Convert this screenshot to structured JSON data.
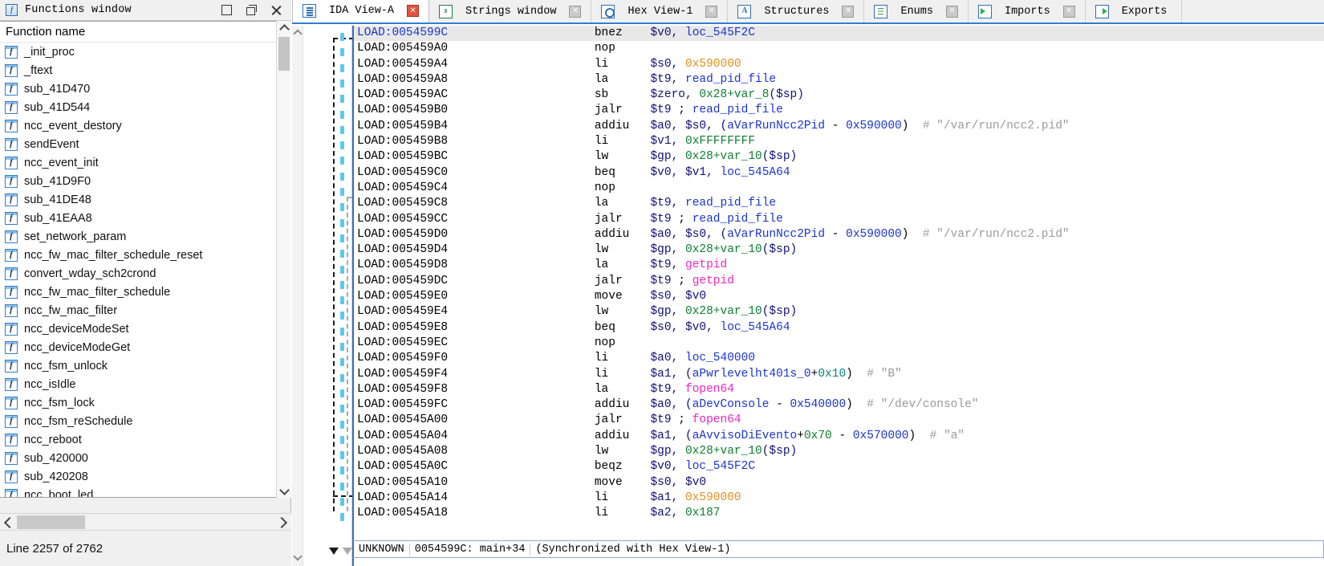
{
  "colors": {
    "accent": "#2f7fd0",
    "cursor_line_bg": "#e8e8e8",
    "address_blue": "#1a35cf",
    "name_green": "#0f8030",
    "number_teal": "#0f8080",
    "immediate_orange": "#e09020",
    "extern_magenta": "#ee25c4",
    "comment_gray": "#9a9a9a",
    "register_navy": "#10107a",
    "arrow_dot_blue": "#5bc8f0"
  },
  "functions_window": {
    "title": "Functions window",
    "title_icon": "function-icon",
    "window_buttons": [
      {
        "name": "restore-button",
        "glyph": "restore"
      },
      {
        "name": "cascade-button",
        "glyph": "cascade"
      },
      {
        "name": "close-button",
        "glyph": "close"
      }
    ],
    "column_header": "Function name",
    "row_icon": "function-icon",
    "items": [
      "_init_proc",
      "_ftext",
      "sub_41D470",
      "sub_41D544",
      "ncc_event_destory",
      "sendEvent",
      "ncc_event_init",
      "sub_41D9F0",
      "sub_41DE48",
      "sub_41EAA8",
      "set_network_param",
      "ncc_fw_mac_filter_schedule_reset",
      "convert_wday_sch2crond",
      "ncc_fw_mac_filter_schedule",
      "ncc_fw_mac_filter",
      "ncc_deviceModeSet",
      "ncc_deviceModeGet",
      "ncc_fsm_unlock",
      "ncc_isIdle",
      "ncc_fsm_lock",
      "ncc_fsm_reSchedule",
      "ncc_reboot",
      "sub_420000",
      "sub_420208",
      "ncc_boot_led"
    ],
    "status": "Line 2257 of 2762"
  },
  "tabs": [
    {
      "label": "IDA View-A",
      "icon": "disassembly-view-icon",
      "active": true,
      "closable": true
    },
    {
      "label": "Strings window",
      "icon": "strings-icon",
      "active": false,
      "closable": true
    },
    {
      "label": "Hex View-1",
      "icon": "hex-view-icon",
      "active": false,
      "closable": true
    },
    {
      "label": "Structures",
      "icon": "structures-icon",
      "active": false,
      "closable": true
    },
    {
      "label": "Enums",
      "icon": "enums-icon",
      "active": false,
      "closable": true
    },
    {
      "label": "Imports",
      "icon": "imports-icon",
      "active": false,
      "closable": true
    },
    {
      "label": "Exports",
      "icon": "exports-icon",
      "active": false,
      "closable": false
    }
  ],
  "disassembly": {
    "lines": [
      {
        "addr": "LOAD:0054599C",
        "mnem": "bnez",
        "cursor": true,
        "ops": [
          {
            "t": "$v0, ",
            "c": "reg"
          },
          {
            "t": "loc_545F2C",
            "c": "c-blue"
          }
        ]
      },
      {
        "addr": "LOAD:005459A0",
        "mnem": "nop",
        "ops": []
      },
      {
        "addr": "LOAD:005459A4",
        "mnem": "li",
        "ops": [
          {
            "t": "$s0, ",
            "c": "reg"
          },
          {
            "t": "0x590000",
            "c": "c-orange"
          }
        ]
      },
      {
        "addr": "LOAD:005459A8",
        "mnem": "la",
        "ops": [
          {
            "t": "$t9, ",
            "c": "reg"
          },
          {
            "t": "read_pid_file",
            "c": "c-blue"
          }
        ]
      },
      {
        "addr": "LOAD:005459AC",
        "mnem": "sb",
        "ops": [
          {
            "t": "$zero, ",
            "c": "reg"
          },
          {
            "t": "0x28+var_8",
            "c": "c-green"
          },
          {
            "t": "($sp)",
            "c": "reg"
          }
        ]
      },
      {
        "addr": "LOAD:005459B0",
        "mnem": "jalr",
        "ops": [
          {
            "t": "$t9 ",
            "c": "reg"
          },
          {
            "t": "; ",
            "c": "c-black"
          },
          {
            "t": "read_pid_file",
            "c": "c-blue"
          }
        ]
      },
      {
        "addr": "LOAD:005459B4",
        "mnem": "addiu",
        "ops": [
          {
            "t": "$a0, $s0, (",
            "c": "reg"
          },
          {
            "t": "aVarRunNcc2Pid",
            "c": "c-blue"
          },
          {
            "t": " - ",
            "c": "c-black"
          },
          {
            "t": "0x590000",
            "c": "c-blue"
          },
          {
            "t": ")",
            "c": "c-black"
          },
          {
            "t": "  # \"/var/run/ncc2.pid\"",
            "c": "c-gray"
          }
        ]
      },
      {
        "addr": "LOAD:005459B8",
        "mnem": "li",
        "ops": [
          {
            "t": "$v1, ",
            "c": "reg"
          },
          {
            "t": "0xFFFFFFFF",
            "c": "c-green"
          }
        ]
      },
      {
        "addr": "LOAD:005459BC",
        "mnem": "lw",
        "ops": [
          {
            "t": "$gp, ",
            "c": "reg"
          },
          {
            "t": "0x28+var_10",
            "c": "c-green"
          },
          {
            "t": "($sp)",
            "c": "reg"
          }
        ]
      },
      {
        "addr": "LOAD:005459C0",
        "mnem": "beq",
        "ops": [
          {
            "t": "$v0, $v1, ",
            "c": "reg"
          },
          {
            "t": "loc_545A64",
            "c": "c-blue"
          }
        ]
      },
      {
        "addr": "LOAD:005459C4",
        "mnem": "nop",
        "ops": []
      },
      {
        "addr": "LOAD:005459C8",
        "mnem": "la",
        "ops": [
          {
            "t": "$t9, ",
            "c": "reg"
          },
          {
            "t": "read_pid_file",
            "c": "c-blue"
          }
        ]
      },
      {
        "addr": "LOAD:005459CC",
        "mnem": "jalr",
        "ops": [
          {
            "t": "$t9 ",
            "c": "reg"
          },
          {
            "t": "; ",
            "c": "c-black"
          },
          {
            "t": "read_pid_file",
            "c": "c-blue"
          }
        ]
      },
      {
        "addr": "LOAD:005459D0",
        "mnem": "addiu",
        "ops": [
          {
            "t": "$a0, $s0, (",
            "c": "reg"
          },
          {
            "t": "aVarRunNcc2Pid",
            "c": "c-blue"
          },
          {
            "t": " - ",
            "c": "c-black"
          },
          {
            "t": "0x590000",
            "c": "c-blue"
          },
          {
            "t": ")",
            "c": "c-black"
          },
          {
            "t": "  # \"/var/run/ncc2.pid\"",
            "c": "c-gray"
          }
        ]
      },
      {
        "addr": "LOAD:005459D4",
        "mnem": "lw",
        "ops": [
          {
            "t": "$gp, ",
            "c": "reg"
          },
          {
            "t": "0x28+var_10",
            "c": "c-green"
          },
          {
            "t": "($sp)",
            "c": "reg"
          }
        ]
      },
      {
        "addr": "LOAD:005459D8",
        "mnem": "la",
        "ops": [
          {
            "t": "$t9, ",
            "c": "reg"
          },
          {
            "t": "getpid",
            "c": "c-magenta"
          }
        ]
      },
      {
        "addr": "LOAD:005459DC",
        "mnem": "jalr",
        "ops": [
          {
            "t": "$t9 ",
            "c": "reg"
          },
          {
            "t": "; ",
            "c": "c-black"
          },
          {
            "t": "getpid",
            "c": "c-magenta"
          }
        ]
      },
      {
        "addr": "LOAD:005459E0",
        "mnem": "move",
        "ops": [
          {
            "t": "$s0, $v0",
            "c": "reg"
          }
        ]
      },
      {
        "addr": "LOAD:005459E4",
        "mnem": "lw",
        "ops": [
          {
            "t": "$gp, ",
            "c": "reg"
          },
          {
            "t": "0x28+var_10",
            "c": "c-green"
          },
          {
            "t": "($sp)",
            "c": "reg"
          }
        ]
      },
      {
        "addr": "LOAD:005459E8",
        "mnem": "beq",
        "ops": [
          {
            "t": "$s0, $v0, ",
            "c": "reg"
          },
          {
            "t": "loc_545A64",
            "c": "c-blue"
          }
        ]
      },
      {
        "addr": "LOAD:005459EC",
        "mnem": "nop",
        "ops": []
      },
      {
        "addr": "LOAD:005459F0",
        "mnem": "li",
        "ops": [
          {
            "t": "$a0, ",
            "c": "reg"
          },
          {
            "t": "loc_540000",
            "c": "c-blue"
          }
        ]
      },
      {
        "addr": "LOAD:005459F4",
        "mnem": "li",
        "ops": [
          {
            "t": "$a1, (",
            "c": "reg"
          },
          {
            "t": "aPwrlevelht401s_0",
            "c": "c-blue"
          },
          {
            "t": "+",
            "c": "c-black"
          },
          {
            "t": "0x10",
            "c": "c-teal"
          },
          {
            "t": ")",
            "c": "c-black"
          },
          {
            "t": "  # \"B\"",
            "c": "c-gray"
          }
        ]
      },
      {
        "addr": "LOAD:005459F8",
        "mnem": "la",
        "ops": [
          {
            "t": "$t9, ",
            "c": "reg"
          },
          {
            "t": "fopen64",
            "c": "c-magenta"
          }
        ]
      },
      {
        "addr": "LOAD:005459FC",
        "mnem": "addiu",
        "ops": [
          {
            "t": "$a0, (",
            "c": "reg"
          },
          {
            "t": "aDevConsole",
            "c": "c-blue"
          },
          {
            "t": " - ",
            "c": "c-black"
          },
          {
            "t": "0x540000",
            "c": "c-blue"
          },
          {
            "t": ")",
            "c": "c-black"
          },
          {
            "t": "  # \"/dev/console\"",
            "c": "c-gray"
          }
        ]
      },
      {
        "addr": "LOAD:00545A00",
        "mnem": "jalr",
        "ops": [
          {
            "t": "$t9 ",
            "c": "reg"
          },
          {
            "t": "; ",
            "c": "c-black"
          },
          {
            "t": "fopen64",
            "c": "c-magenta"
          }
        ]
      },
      {
        "addr": "LOAD:00545A04",
        "mnem": "addiu",
        "ops": [
          {
            "t": "$a1, (",
            "c": "reg"
          },
          {
            "t": "aAvvisoDiEvento",
            "c": "c-blue"
          },
          {
            "t": "+",
            "c": "c-black"
          },
          {
            "t": "0x70",
            "c": "c-green"
          },
          {
            "t": " - ",
            "c": "c-black"
          },
          {
            "t": "0x570000",
            "c": "c-blue"
          },
          {
            "t": ")",
            "c": "c-black"
          },
          {
            "t": "  # \"a\"",
            "c": "c-gray"
          }
        ]
      },
      {
        "addr": "LOAD:00545A08",
        "mnem": "lw",
        "ops": [
          {
            "t": "$gp, ",
            "c": "reg"
          },
          {
            "t": "0x28+var_10",
            "c": "c-green"
          },
          {
            "t": "($sp)",
            "c": "reg"
          }
        ]
      },
      {
        "addr": "LOAD:00545A0C",
        "mnem": "beqz",
        "ops": [
          {
            "t": "$v0, ",
            "c": "reg"
          },
          {
            "t": "loc_545F2C",
            "c": "c-blue"
          }
        ]
      },
      {
        "addr": "LOAD:00545A10",
        "mnem": "move",
        "ops": [
          {
            "t": "$s0, $v0",
            "c": "reg"
          }
        ]
      },
      {
        "addr": "LOAD:00545A14",
        "mnem": "li",
        "ops": [
          {
            "t": "$a1, ",
            "c": "reg"
          },
          {
            "t": "0x590000",
            "c": "c-orange"
          }
        ]
      },
      {
        "addr": "LOAD:00545A18",
        "mnem": "li",
        "ops": [
          {
            "t": "$a2, ",
            "c": "reg"
          },
          {
            "t": "0x187",
            "c": "c-green"
          }
        ]
      }
    ],
    "status": {
      "segment": "UNKNOWN",
      "address": "0054599C: main+34",
      "sync": "(Synchronized with Hex View-1)"
    }
  }
}
